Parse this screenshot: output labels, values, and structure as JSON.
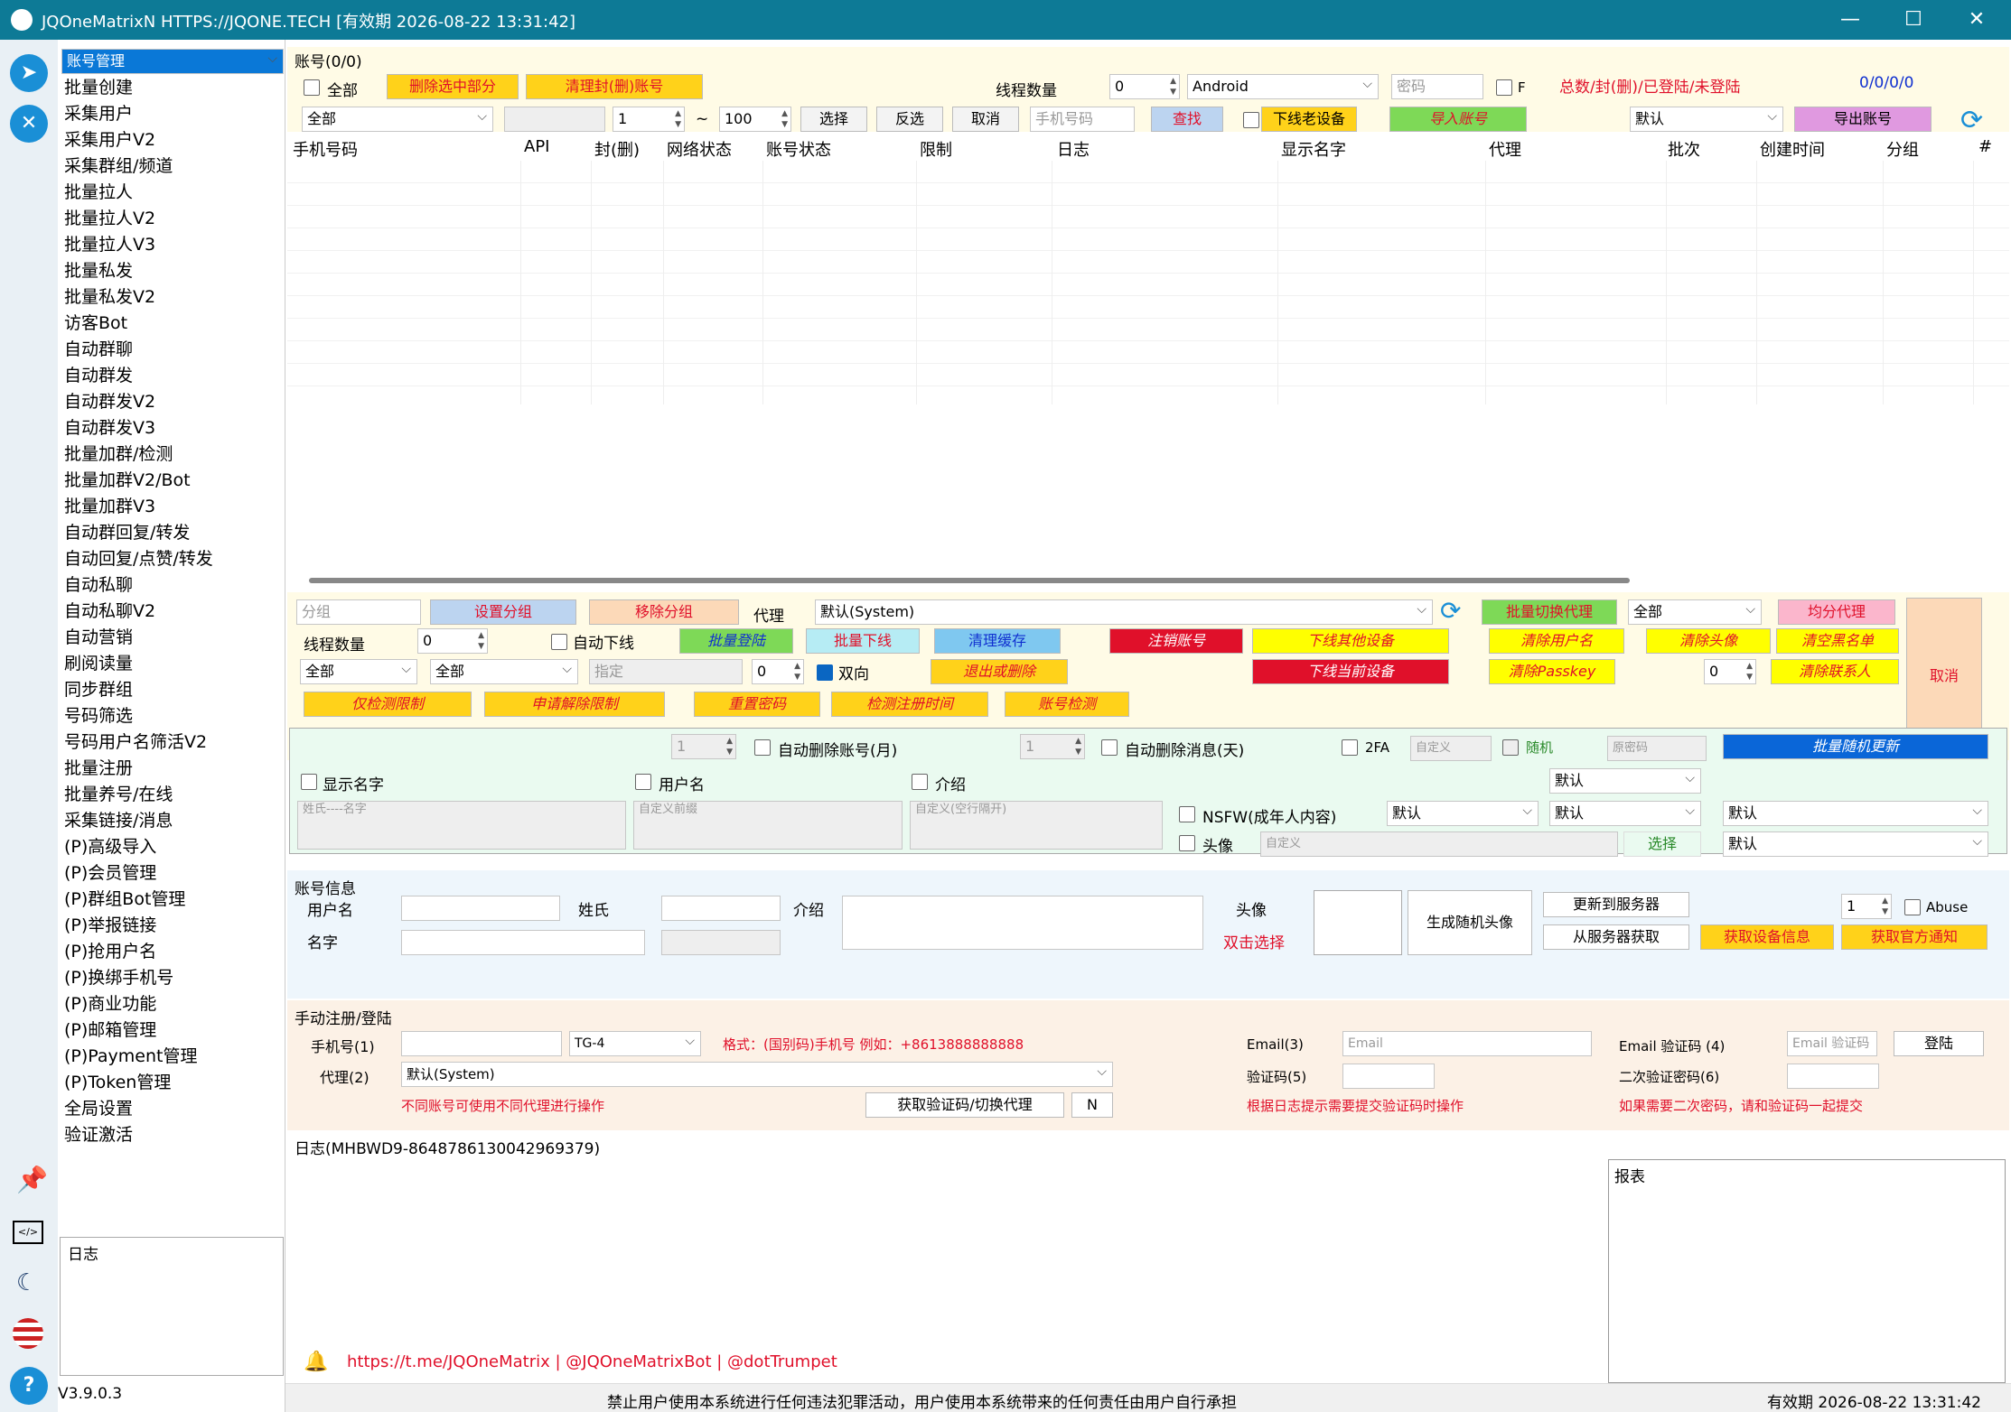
{
  "window": {
    "title": "JQOneMatrixN HTTPS://JQONE.TECH  [有效期 2026-08-22 13:31:42]",
    "minimize": "—",
    "maximize": "☐",
    "close": "✕"
  },
  "sidebar": {
    "items": [
      "账号管理",
      "批量创建",
      "采集用户",
      "采集用户V2",
      "采集群组/频道",
      "批量拉人",
      "批量拉人V2",
      "批量拉人V3",
      "批量私发",
      "批量私发V2",
      "访客Bot",
      "自动群聊",
      "自动群发",
      "自动群发V2",
      "自动群发V3",
      "批量加群/检测",
      "批量加群V2/Bot",
      "批量加群V3",
      "自动群回复/转发",
      "自动回复/点赞/转发",
      "自动私聊",
      "自动私聊V2",
      "自动营销",
      "刷阅读量",
      "同步群组",
      "号码筛选",
      "号码用户名筛活V2",
      "批量注册",
      "批量养号/在线",
      "采集链接/消息",
      "(P)高级导入",
      "(P)会员管理",
      "(P)群组Bot管理",
      "(P)举报链接",
      "(P)抢用户名",
      "(P)换绑手机号",
      "(P)商业功能",
      "(P)邮箱管理",
      "(P)Payment管理",
      "(P)Token管理",
      "全局设置",
      "验证激活"
    ],
    "log_title": "日志",
    "version": "V3.9.0.3"
  },
  "accounts": {
    "group_title": "账号(0/0)",
    "all_label": "全部",
    "delete_selected": "删除选中部分",
    "clear_banned": "清理封(删)账号",
    "thread_count_label": "线程数量",
    "thread_count": "0",
    "platform": "Android",
    "password_placeholder": "密码",
    "f_label": "F",
    "summary_label": "总数/封(删)/已登陆/未登陆",
    "summary_value": "0/0/0/0",
    "filter_all": "全部",
    "range_from": "1",
    "range_sep": "~",
    "range_to": "100",
    "select": "选择",
    "invert": "反选",
    "cancel": "取消",
    "phone_placeholder": "手机号码",
    "find": "查找",
    "offline_devices": "下线老设备",
    "import": "导入账号",
    "default_sel": "默认",
    "export": "导出账号",
    "columns": [
      "手机号码",
      "API",
      "封(删)",
      "网络状态",
      "账号状态",
      "限制",
      "日志",
      "显示名字",
      "代理",
      "批次",
      "创建时间",
      "分组",
      "#"
    ]
  },
  "actions": {
    "group_placeholder": "分组",
    "set_group": "设置分组",
    "remove_group": "移除分组",
    "proxy_label": "代理",
    "proxy_value": "默认(System)",
    "batch_switch_proxy": "批量切换代理",
    "proxy_all": "全部",
    "avg_proxy": "均分代理",
    "cancel": "取消",
    "thread_label": "线程数量",
    "thread_value": "0",
    "auto_offline": "自动下线",
    "batch_login": "批量登陆",
    "batch_offline": "批量下线",
    "clear_cache": "清理缓存",
    "logout_account": "注销账号",
    "offline_other": "下线其他设备",
    "clear_username": "清除用户名",
    "clear_avatar": "清除头像",
    "clear_blacklist": "清空黑名单",
    "sel_all1": "全部",
    "sel_all2": "全部",
    "specify_placeholder": "指定",
    "spin_zero": "0",
    "two_way": "双向",
    "exit_or_delete": "退出或删除",
    "offline_current": "下线当前设备",
    "clear_passkey": "清除Passkey",
    "spin_zero2": "0",
    "clear_contacts": "清除联系人",
    "check_restrict": "仅检测限制",
    "apply_unrestrict": "申请解除限制",
    "reset_password": "重置密码",
    "check_reg_time": "检测注册时间",
    "account_check": "账号检测"
  },
  "profile": {
    "spin1": "1",
    "auto_delete_account": "自动删除账号(月)",
    "spin2": "1",
    "auto_delete_msg": "自动删除消息(天)",
    "twofa": "2FA",
    "custom": "自定义",
    "random": "随机",
    "old_password": "原密码",
    "batch_random_update": "批量随机更新",
    "show_name": "显示名字",
    "username": "用户名",
    "bio": "介绍",
    "default1": "默认",
    "name_hint": "姓氏----名字",
    "prefix_hint": "自定义前缀",
    "bio_hint": "自定义(空行隔开)",
    "nsfw": "NSFW(成年人内容)",
    "default2": "默认",
    "default3": "默认",
    "default4": "默认",
    "avatar": "头像",
    "custom2": "自定义",
    "choose": "选择",
    "default5": "默认"
  },
  "account_info": {
    "title": "账号信息",
    "username": "用户名",
    "lastname": "姓氏",
    "bio": "介绍",
    "name": "名字",
    "avatar": "头像",
    "double_click": "双击选择",
    "gen_avatar": "生成随机头像",
    "update_server": "更新到服务器",
    "fetch_server": "从服务器获取",
    "spin": "1",
    "abuse": "Abuse",
    "get_device": "获取设备信息",
    "get_notice": "获取官方通知"
  },
  "manual": {
    "title": "手动注册/登陆",
    "phone_label": "手机号(1)",
    "tg": "TG-4",
    "format_hint": "格式：(国别码)手机号 例如：+8613888888888",
    "email_label": "Email(3)",
    "email_placeholder": "Email",
    "email_code_label": "Email 验证码 (4)",
    "email_code_placeholder": "Email 验证码",
    "login": "登陆",
    "proxy_label": "代理(2)",
    "proxy_value": "默认(System)",
    "code_label": "验证码(5)",
    "twofa_label": "二次验证密码(6)",
    "diff_proxy_hint": "不同账号可使用不同代理进行操作",
    "get_code": "获取验证码/切换代理",
    "n": "N",
    "log_hint": "根据日志提示需要提交验证码时操作",
    "twofa_hint": "如果需要二次密码，请和验证码一起提交"
  },
  "log": {
    "title": "日志(MHBWD9-8648786130042969379)",
    "report": "报表"
  },
  "footer": {
    "links": "https://t.me/JQOneMatrix | @JQOneMatrixBot | @dotTrumpet",
    "disclaimer": "禁止用户使用本系统进行任何违法犯罪活动，用户使用本系统带来的任何责任由用户自行承担",
    "expiry": "有效期 2026-08-22 13:31:42"
  },
  "colors": {
    "titlebar": "#0d7a96",
    "accent": "#0a78d7",
    "yellow": "#ffff00",
    "red": "#e0102a"
  }
}
